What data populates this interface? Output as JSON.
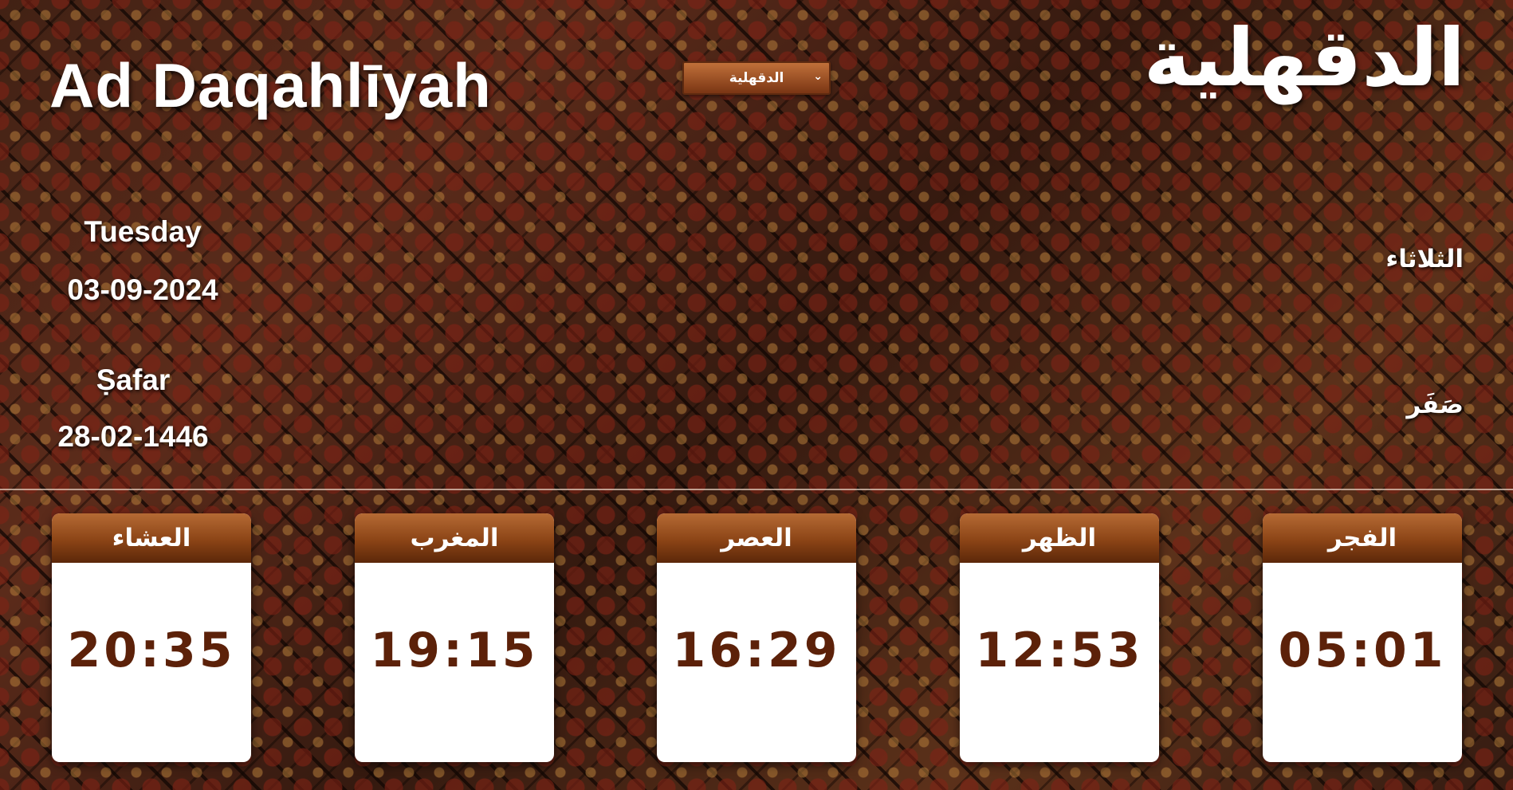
{
  "header": {
    "city_en": "Ad Daqahlīyah",
    "city_ar": "الدقهلية"
  },
  "city_select": {
    "selected": "الدقهلية",
    "icon": "chevron-down-icon"
  },
  "gregorian": {
    "day_en": "Tuesday",
    "date": "03-09-2024"
  },
  "hijri": {
    "month_en": "Ṣafar",
    "date": "28-02-1446"
  },
  "arabic_labels": {
    "day_ar": "الثلاثاء",
    "month_ar": "صَفَر"
  },
  "prayers": [
    {
      "name": "العشاء",
      "time": "20:35"
    },
    {
      "name": "المغرب",
      "time": "19:15"
    },
    {
      "name": "العصر",
      "time": "16:29"
    },
    {
      "name": "الظهر",
      "time": "12:53"
    },
    {
      "name": "الفجر",
      "time": "05:01"
    }
  ],
  "colors": {
    "card_header": "#8b4416",
    "time_text": "#5c2109",
    "select_bg": "#a0522d"
  }
}
